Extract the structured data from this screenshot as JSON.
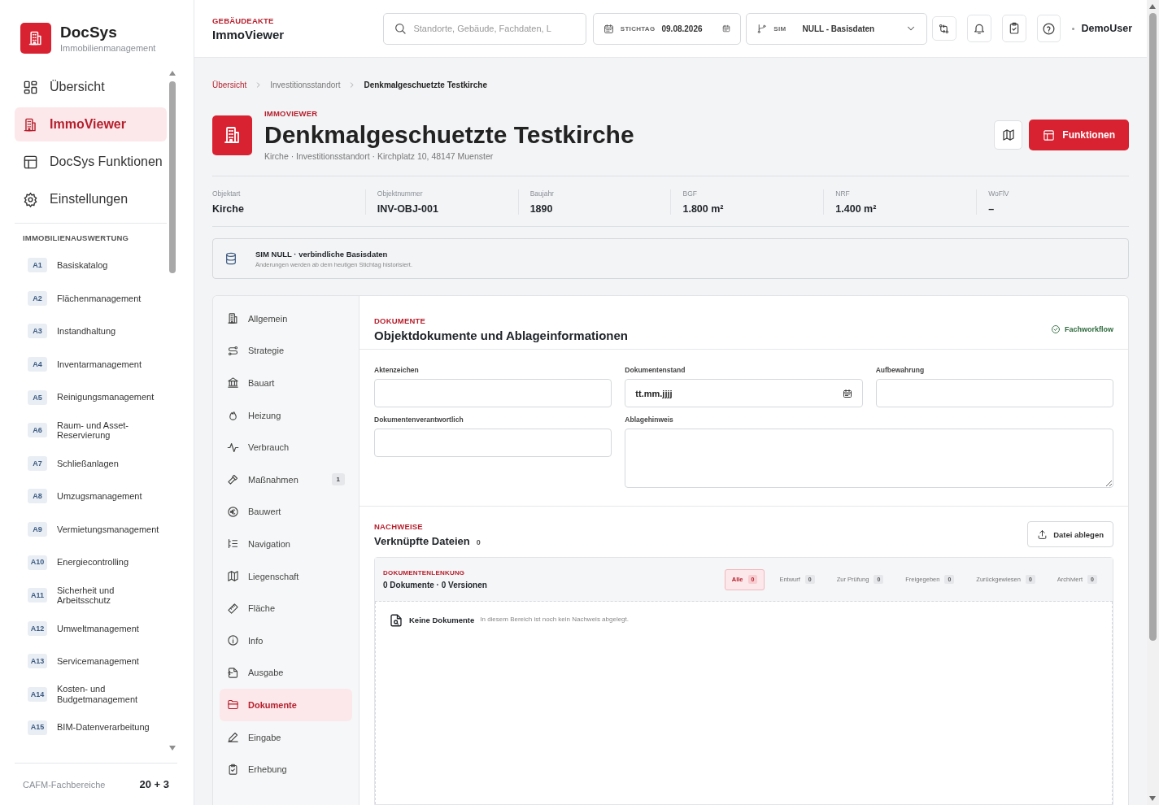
{
  "sidebar": {
    "brand": {
      "name": "DocSys",
      "tagline": "Immobilienmanagement"
    },
    "nav": [
      {
        "label": "Übersicht",
        "selected": false
      },
      {
        "label": "ImmoViewer",
        "selected": true
      },
      {
        "label": "DocSys Funktionen",
        "selected": false
      },
      {
        "label": "Einstellungen",
        "selected": false
      }
    ],
    "section_title": "IMMOBILIENAUSWERTUNG",
    "modules": [
      {
        "code": "A1",
        "label": "Basiskatalog"
      },
      {
        "code": "A2",
        "label": "Flächenmanagement"
      },
      {
        "code": "A3",
        "label": "Instandhaltung"
      },
      {
        "code": "A4",
        "label": "Inventarmanagement"
      },
      {
        "code": "A5",
        "label": "Reinigungsmanagement"
      },
      {
        "code": "A6",
        "label": "Raum- und Asset-Reservierung"
      },
      {
        "code": "A7",
        "label": "Schließanlagen"
      },
      {
        "code": "A8",
        "label": "Umzugsmanagement"
      },
      {
        "code": "A9",
        "label": "Vermietungsmanagement"
      },
      {
        "code": "A10",
        "label": "Energiecontrolling"
      },
      {
        "code": "A11",
        "label": "Sicherheit und Arbeitsschutz"
      },
      {
        "code": "A12",
        "label": "Umweltmanagement"
      },
      {
        "code": "A13",
        "label": "Servicemanagement"
      },
      {
        "code": "A14",
        "label": "Kosten- und Budgetmanagement"
      },
      {
        "code": "A15",
        "label": "BIM-Datenverarbeitung"
      }
    ],
    "footer": {
      "label": "CAFM-Fachbereiche",
      "count": "20 + 3"
    }
  },
  "header": {
    "eyebrow": "GEBÄUDEAKTE",
    "title": "ImmoViewer",
    "search": {
      "placeholder": "Standorte, Gebäude, Fachdaten, L"
    },
    "date": {
      "label": "STICHTAG",
      "value": "09.08.2026"
    },
    "sim": {
      "label": "SIM",
      "value": "NULL - Basisdaten"
    },
    "user": "DemoUser"
  },
  "breadcrumb": [
    {
      "label": "Übersicht",
      "kind": "link"
    },
    {
      "label": "Investitionsstandort",
      "kind": "link"
    },
    {
      "label": "Denkmalgeschuetzte Testkirche",
      "kind": "current"
    }
  ],
  "object": {
    "eyebrow": "IMMOVIEWER",
    "title": "Denkmalgeschuetzte Testkirche",
    "subtitle": "Kirche · Investitionsstandort · Kirchplatz 10, 48147 Muenster",
    "action": "Funktionen"
  },
  "stats": [
    {
      "label": "Objektart",
      "value": "Kirche"
    },
    {
      "label": "Objektnummer",
      "value": "INV-OBJ-001"
    },
    {
      "label": "Baujahr",
      "value": "1890"
    },
    {
      "label": "BGF",
      "value": "1.800 m²"
    },
    {
      "label": "NRF",
      "value": "1.400 m²"
    },
    {
      "label": "WoFlV",
      "value": "–"
    }
  ],
  "notice": {
    "title": "SIM NULL · verbindliche Basisdaten",
    "text": "Änderungen werden ab dem heutigen Stichtag historisiert."
  },
  "tabs": [
    {
      "label": "Allgemein",
      "selected": false
    },
    {
      "label": "Strategie",
      "selected": false
    },
    {
      "label": "Bauart",
      "selected": false
    },
    {
      "label": "Heizung",
      "selected": false
    },
    {
      "label": "Verbrauch",
      "selected": false
    },
    {
      "label": "Maßnahmen",
      "selected": false,
      "badge": "1"
    },
    {
      "label": "Bauwert",
      "selected": false
    },
    {
      "label": "Navigation",
      "selected": false
    },
    {
      "label": "Liegenschaft",
      "selected": false
    },
    {
      "label": "Fläche",
      "selected": false
    },
    {
      "label": "Info",
      "selected": false
    },
    {
      "label": "Ausgabe",
      "selected": false
    },
    {
      "label": "Dokumente",
      "selected": true
    },
    {
      "label": "Eingabe",
      "selected": false
    },
    {
      "label": "Erhebung",
      "selected": false
    }
  ],
  "section": {
    "eyebrow": "DOKUMENTE",
    "title": "Objektdokumente und Ablageinformationen",
    "status": "Fachworkflow",
    "fields": [
      {
        "label": "Aktenzeichen",
        "kind": "text"
      },
      {
        "label": "Dokumentenstand",
        "kind": "date",
        "placeholder": "tt.mm.jjjj"
      },
      {
        "label": "Aufbewahrung",
        "kind": "text"
      },
      {
        "label": "Dokumentenverantwortlich",
        "kind": "text"
      },
      {
        "label": "Ablagehinweis",
        "kind": "textarea"
      }
    ]
  },
  "files": {
    "eyebrow": "NACHWEISE",
    "title": "Verknüpfte Dateien",
    "count": "0",
    "upload": "Datei ablegen",
    "panel_eyebrow": "DOKUMENTENLENKUNG",
    "summary": "0 Dokumente · 0 Versionen",
    "filters": [
      {
        "label": "Alle",
        "count": "0",
        "selected": true
      },
      {
        "label": "Entwurf",
        "count": "0",
        "selected": false
      },
      {
        "label": "Zur Prüfung",
        "count": "0",
        "selected": false
      },
      {
        "label": "Freigegeben",
        "count": "0",
        "selected": false
      },
      {
        "label": "Zurückgewiesen",
        "count": "0",
        "selected": false
      },
      {
        "label": "Archiviert",
        "count": "0",
        "selected": false
      }
    ],
    "empty": {
      "title": "Keine Dokumente",
      "text": "In diesem Bereich ist noch kein Nachweis abgelegt."
    }
  }
}
